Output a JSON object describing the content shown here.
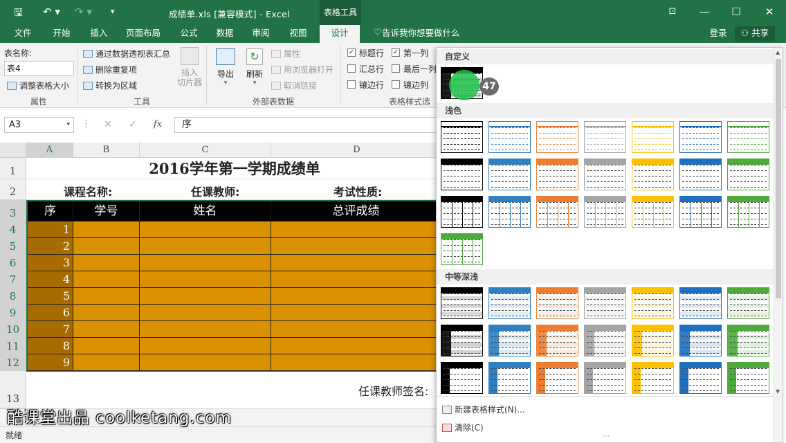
{
  "title_bar": {
    "doc_title": "成绩单.xls  [兼容模式] - Excel",
    "context_tab": "表格工具"
  },
  "tabs": [
    "文件",
    "开始",
    "插入",
    "页面布局",
    "公式",
    "数据",
    "审阅",
    "视图",
    "设计"
  ],
  "tell_me": "告诉我你想要做什么",
  "login": "登录",
  "share": "共享",
  "ribbon": {
    "properties": {
      "table_name_label": "表名称:",
      "table_name_value": "表4",
      "resize": "调整表格大小",
      "group": "属性"
    },
    "tools": {
      "pivot": "通过数据透视表汇总",
      "remove_dup": "删除重复项",
      "convert": "转换为区域",
      "slicer": "插入\n切片器",
      "group": "工具"
    },
    "external": {
      "export": "导出",
      "refresh": "刷新",
      "props": "属性",
      "open_browser": "用浏览器打开",
      "unlink": "取消链接",
      "group": "外部表数据"
    },
    "style_options": {
      "header_row": "标题行",
      "total_row": "汇总行",
      "banded_rows": "镶边行",
      "first_col": "第一列",
      "last_col": "最后一列",
      "banded_cols": "镶边列",
      "group": "表格样式选"
    }
  },
  "formula_bar": {
    "name_box": "A3",
    "fx": "fx",
    "content": "序"
  },
  "sheet": {
    "columns": [
      "A",
      "B",
      "C",
      "D"
    ],
    "title": "2016学年第一学期成绩单",
    "row2": [
      "课程名称:",
      "任课教师:",
      "考试性质:"
    ],
    "headers": [
      "序",
      "学号",
      "姓名",
      "总评成绩"
    ],
    "serials": [
      "1",
      "2",
      "3",
      "4",
      "5",
      "6",
      "7",
      "8",
      "9"
    ],
    "row_numbers": [
      "1",
      "2",
      "3",
      "4",
      "5",
      "6",
      "7",
      "8",
      "9",
      "10",
      "11",
      "12",
      "13"
    ],
    "signature": "任课教师签名:"
  },
  "status": "就绪",
  "gallery": {
    "custom": "自定义",
    "light": "浅色",
    "medium": "中等深浅",
    "badge": "47",
    "new_style": "新建表格样式(N)...",
    "clear": "清除(C)"
  },
  "watermark": "酷课堂出品 coolketang.com",
  "colors": {
    "excel_green": "#217346",
    "table_fill": "#d99100",
    "table_dark": "#a86b00",
    "header_black": "#000000",
    "highlight": "#1fc14a"
  }
}
